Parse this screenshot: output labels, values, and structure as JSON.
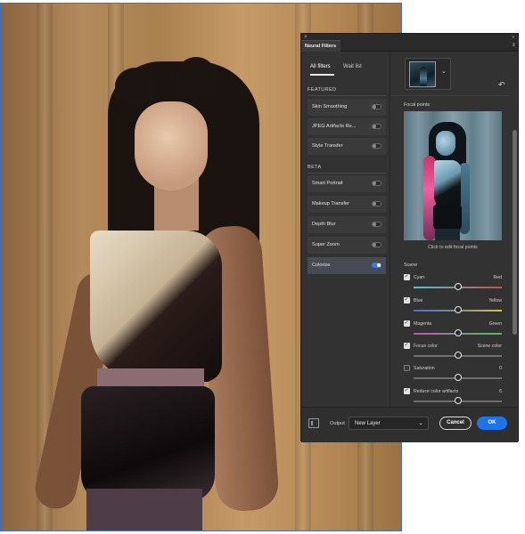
{
  "panel": {
    "title": "Neural Filters",
    "close_glyph": "×",
    "collapse_glyph": "»",
    "menu_glyph": "≡"
  },
  "list_tabs": {
    "all": "All filters",
    "wait": "Wait list"
  },
  "sections": {
    "featured": "FEATURED",
    "beta": "BETA"
  },
  "featured_filters": [
    {
      "label": "Skin Smoothing",
      "on": false
    },
    {
      "label": "JPEG Artifacts Re...",
      "on": false
    },
    {
      "label": "Style Transfer",
      "on": false
    }
  ],
  "beta_filters": [
    {
      "label": "Smart Portrait",
      "on": false
    },
    {
      "label": "Makeup Transfer",
      "on": false
    },
    {
      "label": "Depth Blur",
      "on": false
    },
    {
      "label": "Super Zoom",
      "on": false
    },
    {
      "label": "Colorize",
      "on": true
    }
  ],
  "colorize": {
    "chevron_glyph": "⌄",
    "reset_glyph": "↶",
    "focal_points_label": "Focal points",
    "focal_caption": "Click to edit focal points",
    "scene_label": "Scene",
    "check_glyph": "✓",
    "controls": [
      {
        "left": "Cyan",
        "right": "Red",
        "checked": true,
        "value": 0.5,
        "track": "cyan-red"
      },
      {
        "left": "Blue",
        "right": "Yellow",
        "checked": true,
        "value": 0.5,
        "track": "blue-yellow"
      },
      {
        "left": "Magenta",
        "right": "Green",
        "checked": true,
        "value": 0.5,
        "track": "magenta-green"
      },
      {
        "left": "Focus color",
        "right": "Scene color",
        "checked": true,
        "value": 0.5,
        "track": "plain"
      },
      {
        "left": "Saturation",
        "right": "0",
        "checked": false,
        "value": 0.5,
        "track": "plain"
      },
      {
        "left": "Reduce color artifacts",
        "right": "6",
        "checked": true,
        "value": 0.5,
        "track": "plain"
      }
    ]
  },
  "footer": {
    "output_label": "Output",
    "output_value": "New Layer",
    "output_chevron": "⌄",
    "cancel_label": "Cancel",
    "ok_label": "OK"
  },
  "colors": {
    "panel_bg": "#323232",
    "accent": "#1f73e8",
    "canvas_border": "#3d72c2"
  }
}
